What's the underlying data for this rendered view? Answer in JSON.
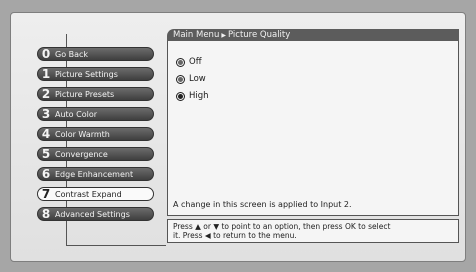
{
  "breadcrumb": {
    "root": "Main Menu",
    "current": "Picture Quality"
  },
  "menu": [
    {
      "num": "0",
      "label": "Go Back",
      "active": false
    },
    {
      "num": "1",
      "label": "Picture Settings",
      "active": false
    },
    {
      "num": "2",
      "label": "Picture Presets",
      "active": false
    },
    {
      "num": "3",
      "label": "Auto Color",
      "active": false
    },
    {
      "num": "4",
      "label": "Color Warmth",
      "active": false
    },
    {
      "num": "5",
      "label": "Convergence",
      "active": false
    },
    {
      "num": "6",
      "label": "Edge Enhancement",
      "active": false
    },
    {
      "num": "7",
      "label": "Contrast Expand",
      "active": true
    },
    {
      "num": "8",
      "label": "Advanced Settings",
      "active": false
    }
  ],
  "options": [
    {
      "label": "Off",
      "selected": false
    },
    {
      "label": "Low",
      "selected": false
    },
    {
      "label": "High",
      "selected": true
    }
  ],
  "note": "A change in this screen is applied to Input 2.",
  "help": {
    "line1": "Press ▲ or ▼ to point to an option, then press OK to select",
    "line2": "it. Press ◀ to return to the menu."
  }
}
